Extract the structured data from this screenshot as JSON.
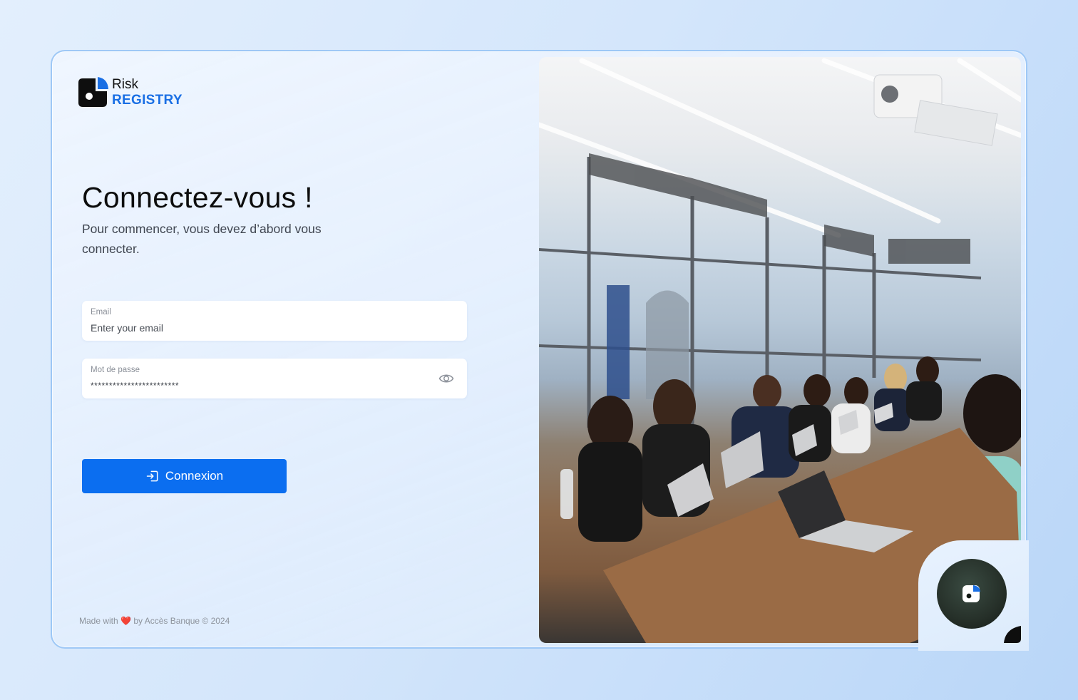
{
  "brand": {
    "name_line1": "Risk",
    "name_line2": "REGISTRY",
    "accent_color": "#0b6ef0"
  },
  "login": {
    "title": "Connectez-vous !",
    "subtitle": "Pour commencer, vous devez d’abord vous connecter.",
    "email": {
      "label": "Email",
      "placeholder": "Enter your email",
      "value": ""
    },
    "password": {
      "label": "Mot de passe",
      "value": "************************",
      "toggle_icon": "eye-icon"
    },
    "submit": {
      "label": "Connexion",
      "icon": "login-icon"
    }
  },
  "footer": {
    "prefix": "Made with",
    "heart": "❤️",
    "suffix": "by Accès Banque © 2024"
  },
  "hero": {
    "image_icon": "meeting-photo",
    "badge_icon": "risk-registry-logo-icon"
  }
}
